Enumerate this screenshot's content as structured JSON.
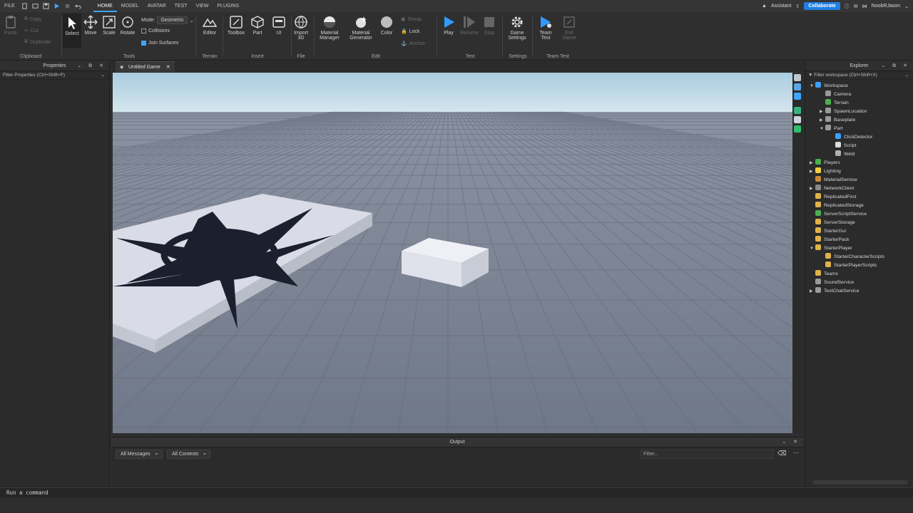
{
  "menu": {
    "file": "FILE",
    "tabs": [
      "HOME",
      "MODEL",
      "AVATAR",
      "TEST",
      "VIEW",
      "PLUGINS"
    ],
    "active_tab": "HOME",
    "assistant": "Assistant",
    "collaborate": "Collaborate",
    "username": "NoobRJason"
  },
  "ribbon": {
    "clipboard": {
      "paste": "Paste",
      "copy": "Copy",
      "cut": "Cut",
      "duplicate": "Duplicate",
      "label": "Clipboard"
    },
    "tools": {
      "select": "Select",
      "move": "Move",
      "scale": "Scale",
      "rotate": "Rotate",
      "mode_label": "Mode:",
      "mode_value": "Geometric",
      "collisions": "Collisions",
      "join_surfaces": "Join Surfaces",
      "label": "Tools"
    },
    "terrain": {
      "editor": "Editor",
      "label": "Terrain"
    },
    "insert": {
      "toolbox": "Toolbox",
      "part": "Part",
      "ui": "UI",
      "label": "Insert"
    },
    "file": {
      "import3d": "Import 3D",
      "label": "File"
    },
    "edit": {
      "material_manager": "Material Manager",
      "material_generator": "Material Generator",
      "color": "Color",
      "group": "Group",
      "lock": "Lock",
      "anchor": "Anchor",
      "label": "Edit"
    },
    "test": {
      "play": "Play",
      "resume": "Resume",
      "stop": "Stop",
      "label": "Test"
    },
    "settings": {
      "game_settings": "Game Settings",
      "label": "Settings"
    },
    "team_test": {
      "team_test": "Team Test",
      "exit_game": "Exit Game",
      "label": "Team Test"
    }
  },
  "properties": {
    "title": "Properties",
    "filter": "Filter Properties (Ctrl+Shift+P)"
  },
  "document": {
    "tab": "Untitled Game"
  },
  "output": {
    "title": "Output",
    "messages": "All Messages",
    "contexts": "All Contexts",
    "filter": "Filter..."
  },
  "explorer": {
    "title": "Explorer",
    "filter": "Filter workspace (Ctrl+Shift+X)",
    "items": [
      {
        "label": "Workspace",
        "arrow": "▼",
        "color": "#3aa0ff"
      },
      {
        "label": "Camera",
        "arrow": "",
        "color": "#9a9a9a"
      },
      {
        "label": "Terrain",
        "arrow": "",
        "color": "#4caf50"
      },
      {
        "label": "SpawnLocation",
        "arrow": "▶",
        "color": "#9a9a9a"
      },
      {
        "label": "Baseplate",
        "arrow": "▶",
        "color": "#9a9a9a"
      },
      {
        "label": "Part",
        "arrow": "▼",
        "color": "#9a9a9a"
      },
      {
        "label": "ClickDetector",
        "arrow": "",
        "color": "#3aa0ff"
      },
      {
        "label": "Script",
        "arrow": "",
        "color": "#dcdcdc"
      },
      {
        "label": "Weld",
        "arrow": "",
        "color": "#b0b0b0"
      },
      {
        "label": "Players",
        "arrow": "▶",
        "color": "#4caf50"
      },
      {
        "label": "Lighting",
        "arrow": "▶",
        "color": "#f5d142"
      },
      {
        "label": "MaterialService",
        "arrow": "",
        "color": "#c88a3a"
      },
      {
        "label": "NetworkClient",
        "arrow": "▶",
        "color": "#8a8a8a"
      },
      {
        "label": "ReplicatedFirst",
        "arrow": "",
        "color": "#e0b34a"
      },
      {
        "label": "ReplicatedStorage",
        "arrow": "",
        "color": "#e0b34a"
      },
      {
        "label": "ServerScriptService",
        "arrow": "",
        "color": "#4caf50"
      },
      {
        "label": "ServerStorage",
        "arrow": "",
        "color": "#e0b34a"
      },
      {
        "label": "StarterGui",
        "arrow": "",
        "color": "#e0b34a"
      },
      {
        "label": "StarterPack",
        "arrow": "",
        "color": "#e0b34a"
      },
      {
        "label": "StarterPlayer",
        "arrow": "▼",
        "color": "#e0b34a"
      },
      {
        "label": "StarterCharacterScripts",
        "arrow": "",
        "color": "#e0b34a"
      },
      {
        "label": "StarterPlayerScripts",
        "arrow": "",
        "color": "#e0b34a"
      },
      {
        "label": "Teams",
        "arrow": "",
        "color": "#e0b34a"
      },
      {
        "label": "SoundService",
        "arrow": "",
        "color": "#9a9a9a"
      },
      {
        "label": "TextChatService",
        "arrow": "▶",
        "color": "#9a9a9a"
      }
    ]
  },
  "command": {
    "placeholder": "Run a command"
  }
}
